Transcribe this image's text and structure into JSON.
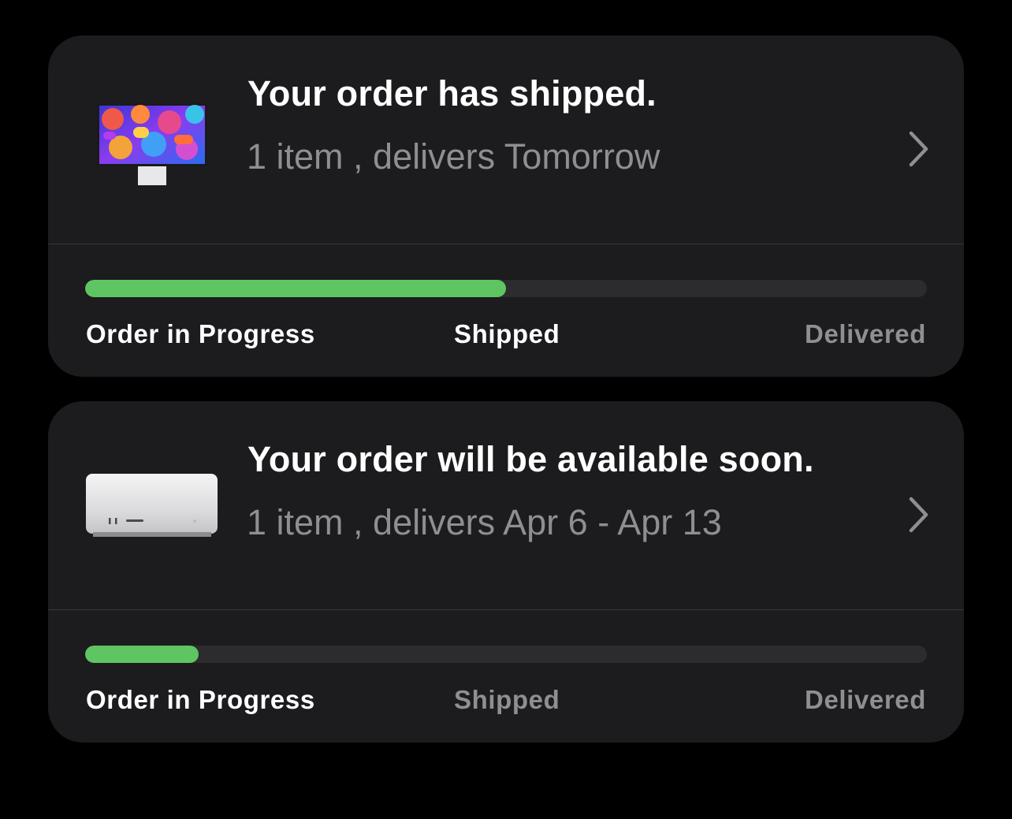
{
  "orders": [
    {
      "product_icon": "studio-display-icon",
      "title": "Your order has shipped.",
      "subtitle": "1 item , delivers Tomorrow",
      "progress": 0.5,
      "steps": [
        {
          "label": "Order in Progress",
          "state": "done"
        },
        {
          "label": "Shipped",
          "state": "done"
        },
        {
          "label": "Delivered",
          "state": "pending"
        }
      ]
    },
    {
      "product_icon": "mac-studio-icon",
      "title": "Your order will be available soon.",
      "subtitle": "1 item , delivers Apr 6 - Apr 13",
      "progress": 0.135,
      "steps": [
        {
          "label": "Order in Progress",
          "state": "done"
        },
        {
          "label": "Shipped",
          "state": "pending"
        },
        {
          "label": "Delivered",
          "state": "pending"
        }
      ]
    }
  ],
  "colors": {
    "background": "#000000",
    "card": "#1c1c1e",
    "progress_fill": "#5fc562",
    "progress_track": "#2c2c2e",
    "secondary_text": "#8e8e93"
  }
}
